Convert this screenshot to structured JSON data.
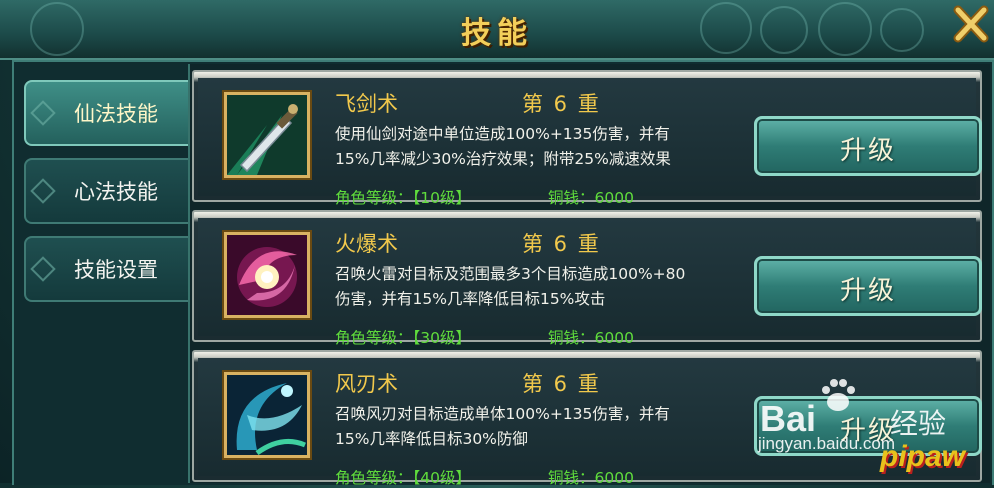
{
  "header": {
    "title": "技能"
  },
  "tabs": [
    {
      "label": "仙法技能",
      "active": true
    },
    {
      "label": "心法技能",
      "active": false
    },
    {
      "label": "技能设置",
      "active": false
    }
  ],
  "skills": [
    {
      "name": "飞剑术",
      "level": "第 6 重",
      "desc_line1": "使用仙剑对途中单位造成100%+135伤害，并有",
      "desc_line2": "15%几率减少30%治疗效果；附带25%减速效果",
      "req_level": "角色等级：【10级】",
      "cost": "铜钱：6000",
      "button_label": "升级",
      "icon": "sword-icon"
    },
    {
      "name": "火爆术",
      "level": "第 6 重",
      "desc_line1": "召唤火雷对目标及范围最多3个目标造成100%+80",
      "desc_line2": "伤害，并有15%几率降低目标15%攻击",
      "req_level": "角色等级：【30级】",
      "cost": "铜钱：6000",
      "button_label": "升级",
      "icon": "fire-orb-icon"
    },
    {
      "name": "风刃术",
      "level": "第 6 重",
      "desc_line1": "召唤风刃对目标造成单体100%+135伤害，并有",
      "desc_line2": "15%几率降低目标30%防御",
      "req_level": "角色等级：【40级】",
      "cost": "铜钱：6000",
      "button_label": "升级",
      "icon": "wind-blade-icon"
    }
  ],
  "watermark": {
    "brand": "Bai",
    "brand_suffix": "经验",
    "url": "jingyan.baidu.com",
    "logo": "pipaw"
  },
  "colors": {
    "gold": "#f2c94c",
    "green": "#5fdc3c",
    "teal": "#2f7d76"
  }
}
